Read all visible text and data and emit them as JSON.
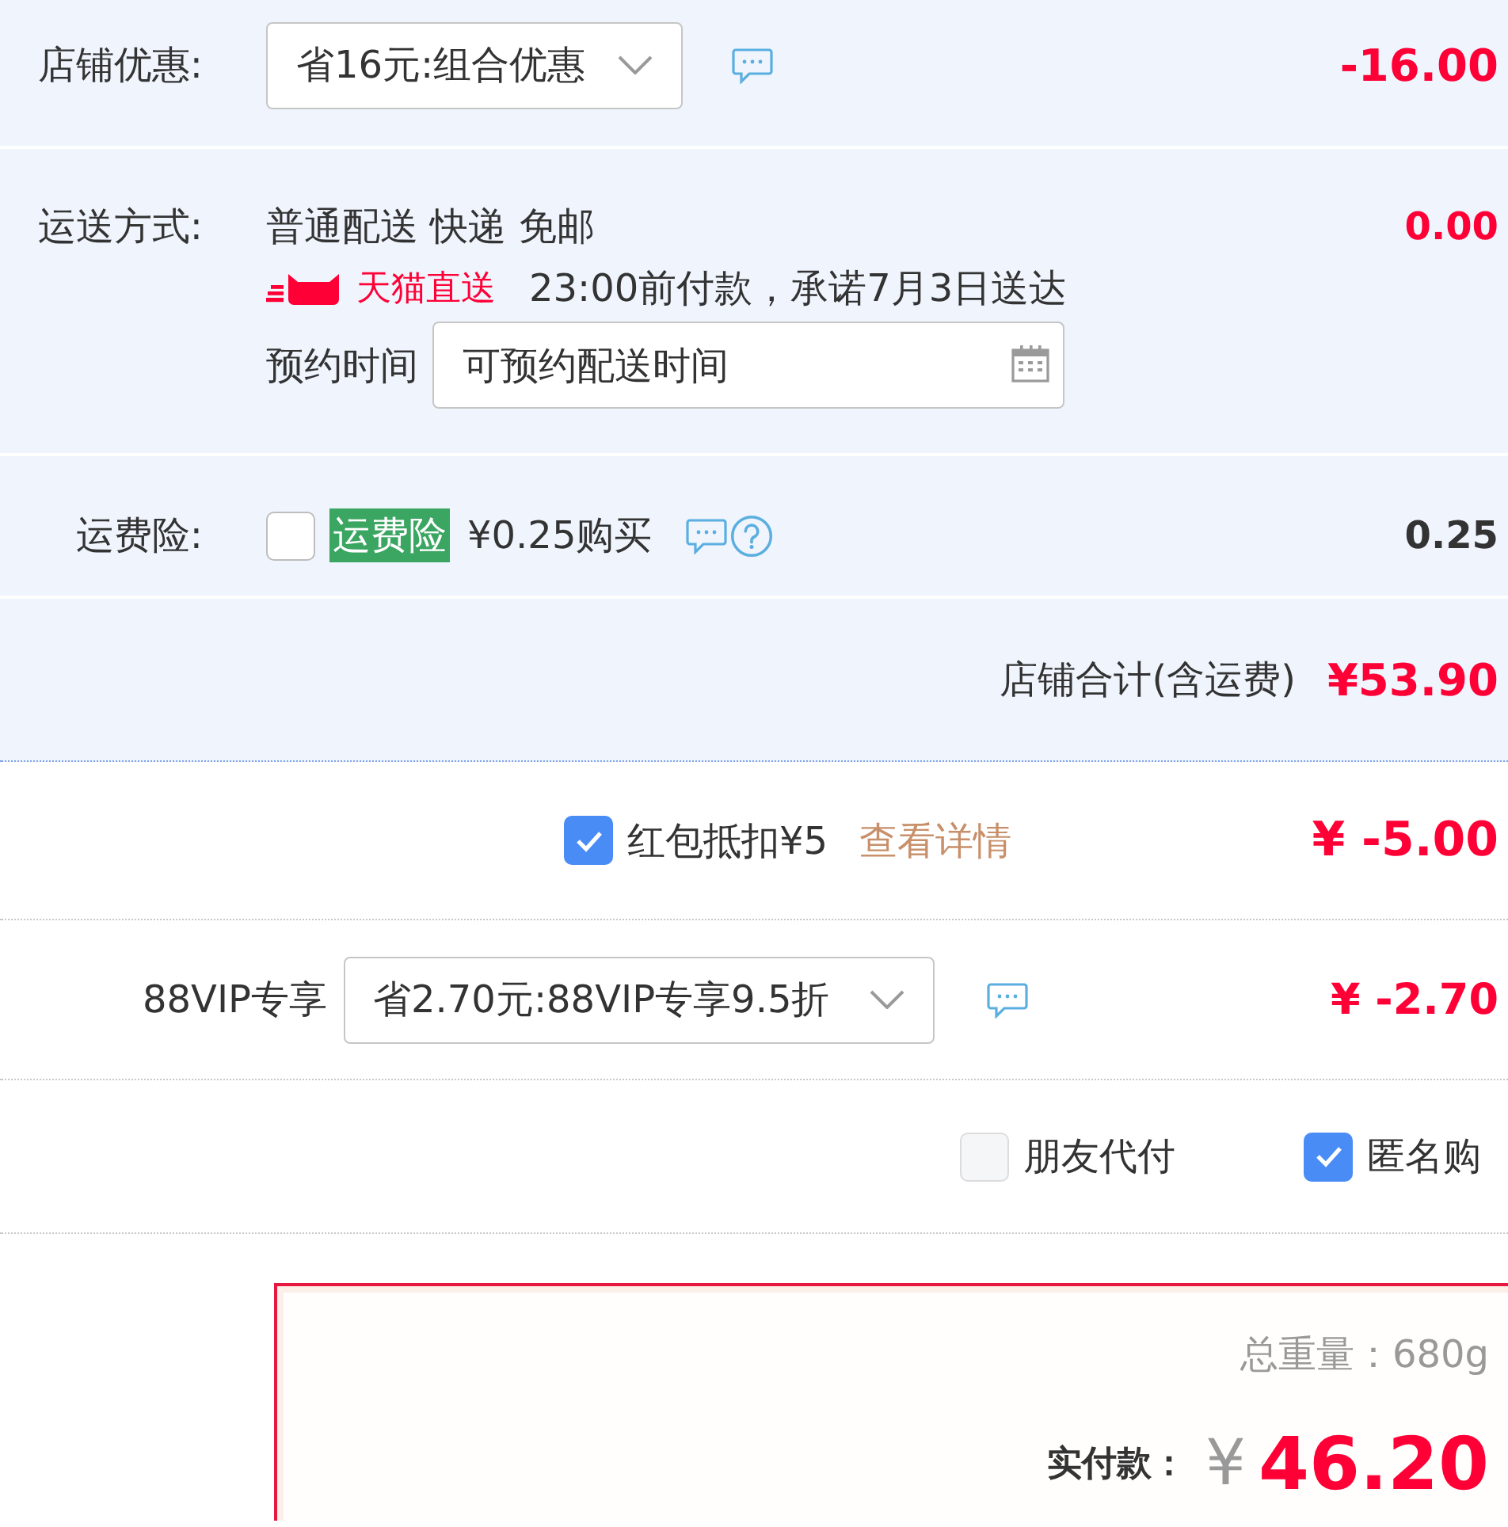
{
  "shop_discount": {
    "label": "店铺优惠:",
    "select_value": "省16元:组合优惠",
    "amount": "-16.00"
  },
  "shipping": {
    "label": "运送方式:",
    "method": "普通配送 快递 免邮",
    "badge": "天猫直送",
    "promise": "23:00前付款，承诺7月3日送达",
    "schedule_label": "预约时间",
    "schedule_field": {
      "placeholder": "可预约配送时间"
    },
    "amount": "0.00"
  },
  "insurance": {
    "label": "运费险:",
    "checked": false,
    "tag": "运费险",
    "price": "¥0.25购买",
    "amount": "0.25"
  },
  "shop_total": {
    "label": "店铺合计(含运费)",
    "amount": "¥53.90"
  },
  "red_packet": {
    "checked": true,
    "label": "红包抵扣¥5",
    "link": "查看详情",
    "amount": "¥ -5.00"
  },
  "vip": {
    "label": "88VIP专享",
    "select_value": "省2.70元:88VIP专享9.5折",
    "amount": "¥ -2.70"
  },
  "options": [
    {
      "label": "朋友代付",
      "checked": false
    },
    {
      "label": "匿名购",
      "checked": true
    }
  ],
  "summary": {
    "weight": "总重量：680g",
    "pay_label": "实付款：",
    "currency": "¥",
    "total": "46.20"
  }
}
